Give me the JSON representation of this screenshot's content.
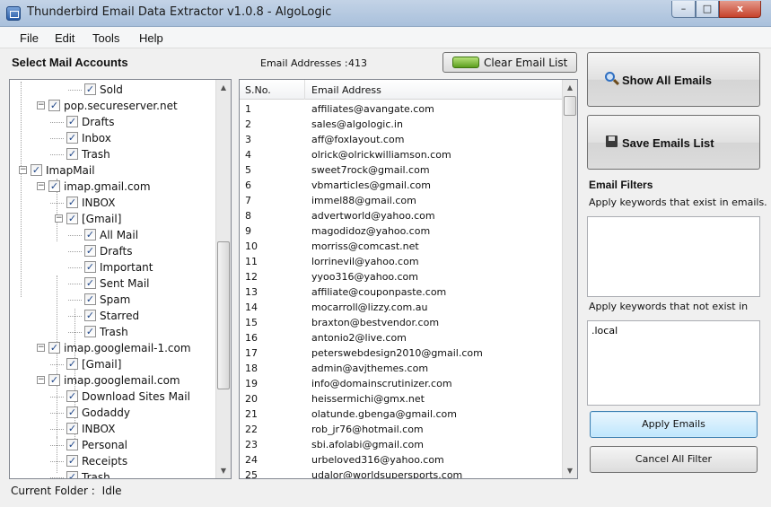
{
  "window": {
    "title": "Thunderbird Email Data Extractor v1.0.8 - AlgoLogic",
    "close_glyph": "x",
    "min_glyph": "–",
    "max_glyph": "□"
  },
  "menu": {
    "file": "File",
    "edit": "Edit",
    "tools": "Tools",
    "help": "Help"
  },
  "accounts": {
    "title": "Select Mail Accounts",
    "tree": [
      {
        "label": "Sold",
        "level": 3,
        "expander": ""
      },
      {
        "label": "pop.secureserver.net",
        "level": 1,
        "expander": "−"
      },
      {
        "label": "Drafts",
        "level": 2,
        "expander": ""
      },
      {
        "label": "Inbox",
        "level": 2,
        "expander": ""
      },
      {
        "label": "Trash",
        "level": 2,
        "expander": ""
      },
      {
        "label": "ImapMail",
        "level": 0,
        "expander": "−"
      },
      {
        "label": "imap.gmail.com",
        "level": 1,
        "expander": "−"
      },
      {
        "label": "INBOX",
        "level": 2,
        "expander": ""
      },
      {
        "label": "[Gmail]",
        "level": 2,
        "expander": "−"
      },
      {
        "label": "All Mail",
        "level": 3,
        "expander": ""
      },
      {
        "label": "Drafts",
        "level": 3,
        "expander": ""
      },
      {
        "label": "Important",
        "level": 3,
        "expander": ""
      },
      {
        "label": "Sent Mail",
        "level": 3,
        "expander": ""
      },
      {
        "label": "Spam",
        "level": 3,
        "expander": ""
      },
      {
        "label": "Starred",
        "level": 3,
        "expander": ""
      },
      {
        "label": "Trash",
        "level": 3,
        "expander": ""
      },
      {
        "label": "imap.googlemail-1.com",
        "level": 1,
        "expander": "−"
      },
      {
        "label": "[Gmail]",
        "level": 2,
        "expander": ""
      },
      {
        "label": "imap.googlemail.com",
        "level": 1,
        "expander": "−"
      },
      {
        "label": "Download Sites Mail",
        "level": 2,
        "expander": ""
      },
      {
        "label": "Godaddy",
        "level": 2,
        "expander": ""
      },
      {
        "label": "INBOX",
        "level": 2,
        "expander": ""
      },
      {
        "label": "Personal",
        "level": 2,
        "expander": ""
      },
      {
        "label": "Receipts",
        "level": 2,
        "expander": ""
      },
      {
        "label": "Trash",
        "level": 2,
        "expander": ""
      }
    ]
  },
  "status": {
    "label": "Current Folder :",
    "value": "Idle"
  },
  "emails": {
    "count_label": "Email Addresses :",
    "count": "413",
    "clear_label": "Clear Email List",
    "col_sno": "S.No.",
    "col_email": "Email Address",
    "rows": [
      [
        "1",
        "affiliates@avangate.com"
      ],
      [
        "2",
        "sales@algologic.in"
      ],
      [
        "3",
        "aff@foxlayout.com"
      ],
      [
        "4",
        "olrick@olrickwilliamson.com"
      ],
      [
        "5",
        "sweet7rock@gmail.com"
      ],
      [
        "6",
        "vbmarticles@gmail.com"
      ],
      [
        "7",
        "immel88@gmail.com"
      ],
      [
        "8",
        "advertworld@yahoo.com"
      ],
      [
        "9",
        "magodidoz@yahoo.com"
      ],
      [
        "10",
        "morriss@comcast.net"
      ],
      [
        "11",
        "lorrinevil@yahoo.com"
      ],
      [
        "12",
        "yyoo316@yahoo.com"
      ],
      [
        "13",
        "affiliate@couponpaste.com"
      ],
      [
        "14",
        "mocarroll@lizzy.com.au"
      ],
      [
        "15",
        "braxton@bestvendor.com"
      ],
      [
        "16",
        "antonio2@live.com"
      ],
      [
        "17",
        "peterswebdesign2010@gmail.com"
      ],
      [
        "18",
        "admin@avjthemes.com"
      ],
      [
        "19",
        "info@domainscrutinizer.com"
      ],
      [
        "20",
        "heissermichi@gmx.net"
      ],
      [
        "21",
        "olatunde.gbenga@gmail.com"
      ],
      [
        "22",
        "rob_jr76@hotmail.com"
      ],
      [
        "23",
        "sbi.afolabi@gmail.com"
      ],
      [
        "24",
        "urbeloved316@yahoo.com"
      ],
      [
        "25",
        "udalor@worldsupersports.com"
      ]
    ]
  },
  "actions": {
    "show_all": "Show All Emails",
    "save_list": "Save Emails List"
  },
  "filters": {
    "title": "Email Filters",
    "include_label": "Apply keywords that exist in emails.",
    "include_value": "",
    "exclude_label": "Apply keywords that not exist in",
    "exclude_value": ".local",
    "apply_label": "Apply Emails",
    "cancel_label": "Cancel All Filter"
  }
}
